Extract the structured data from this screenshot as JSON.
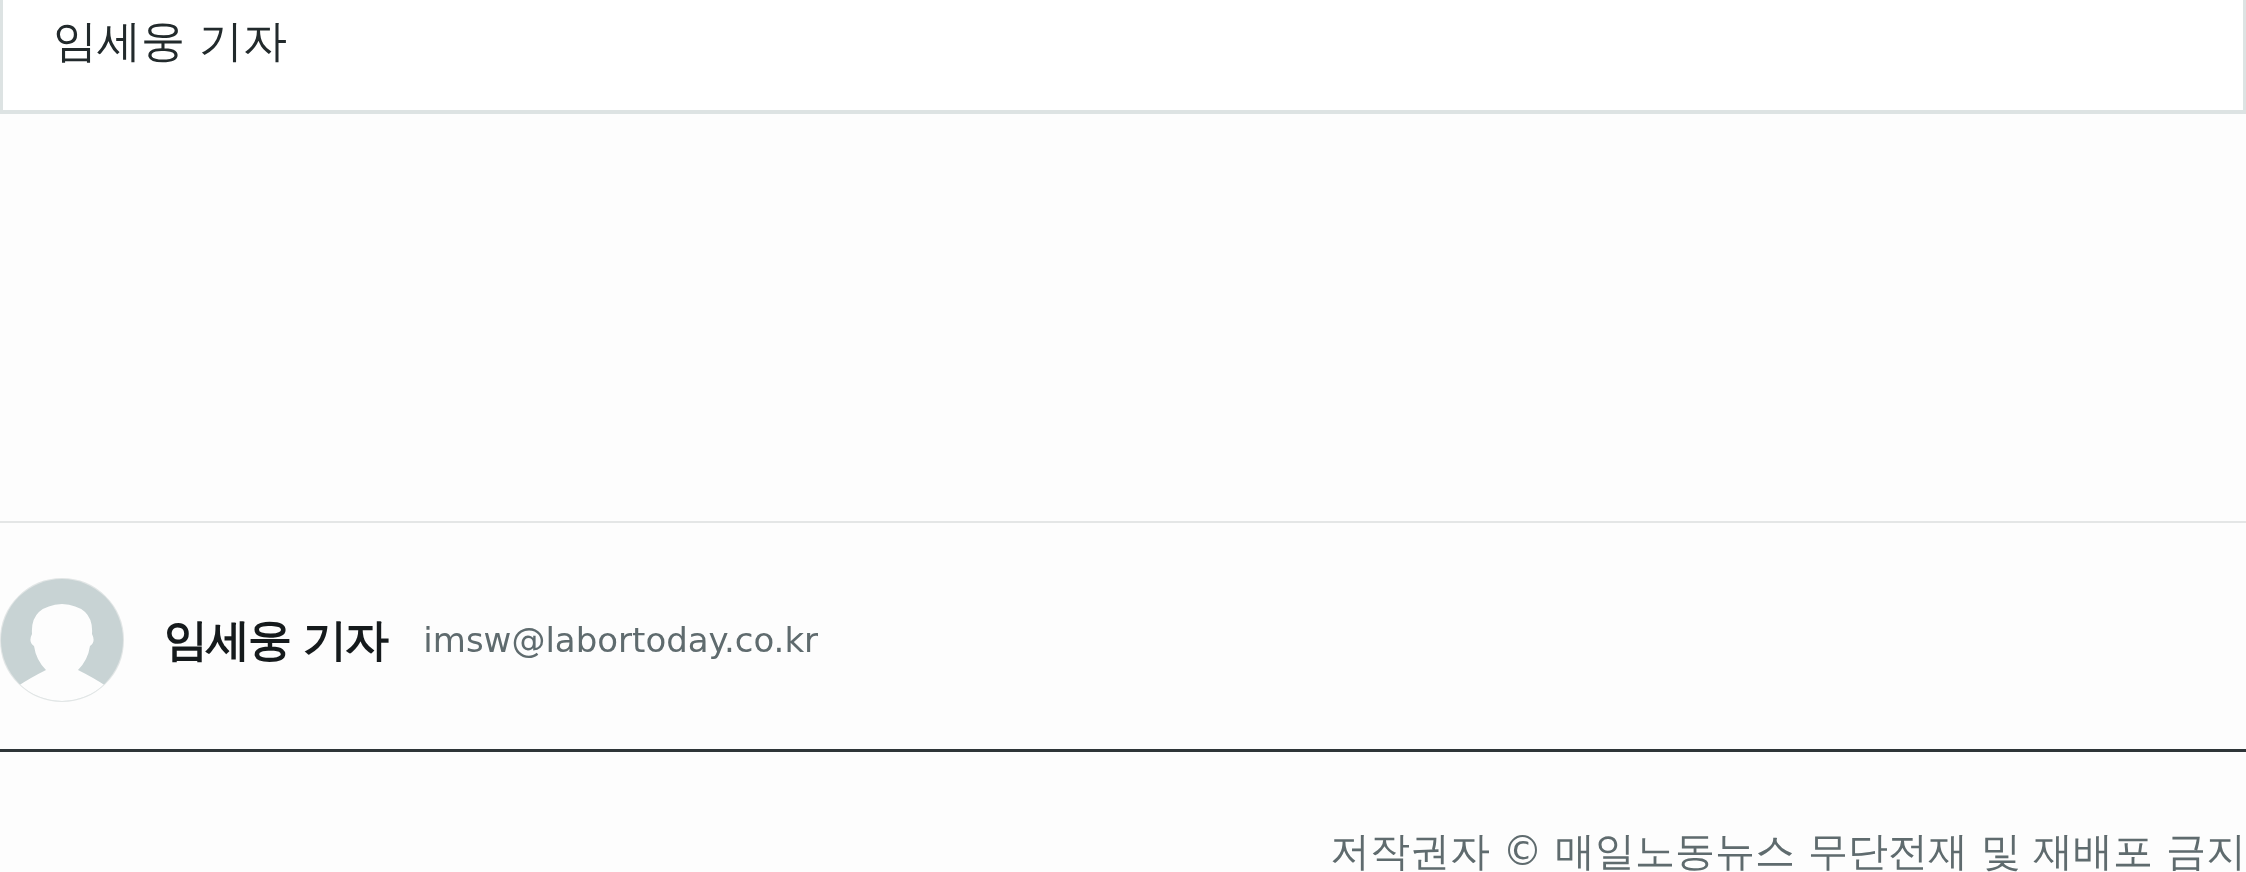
{
  "byline_box": {
    "text": "임세웅 기자"
  },
  "author": {
    "name": "임세웅 기자",
    "email": "imsw@labortoday.co.kr"
  },
  "copyright": "저작권자 © 매일노동뉴스 무단전재 및 재배포 금지"
}
